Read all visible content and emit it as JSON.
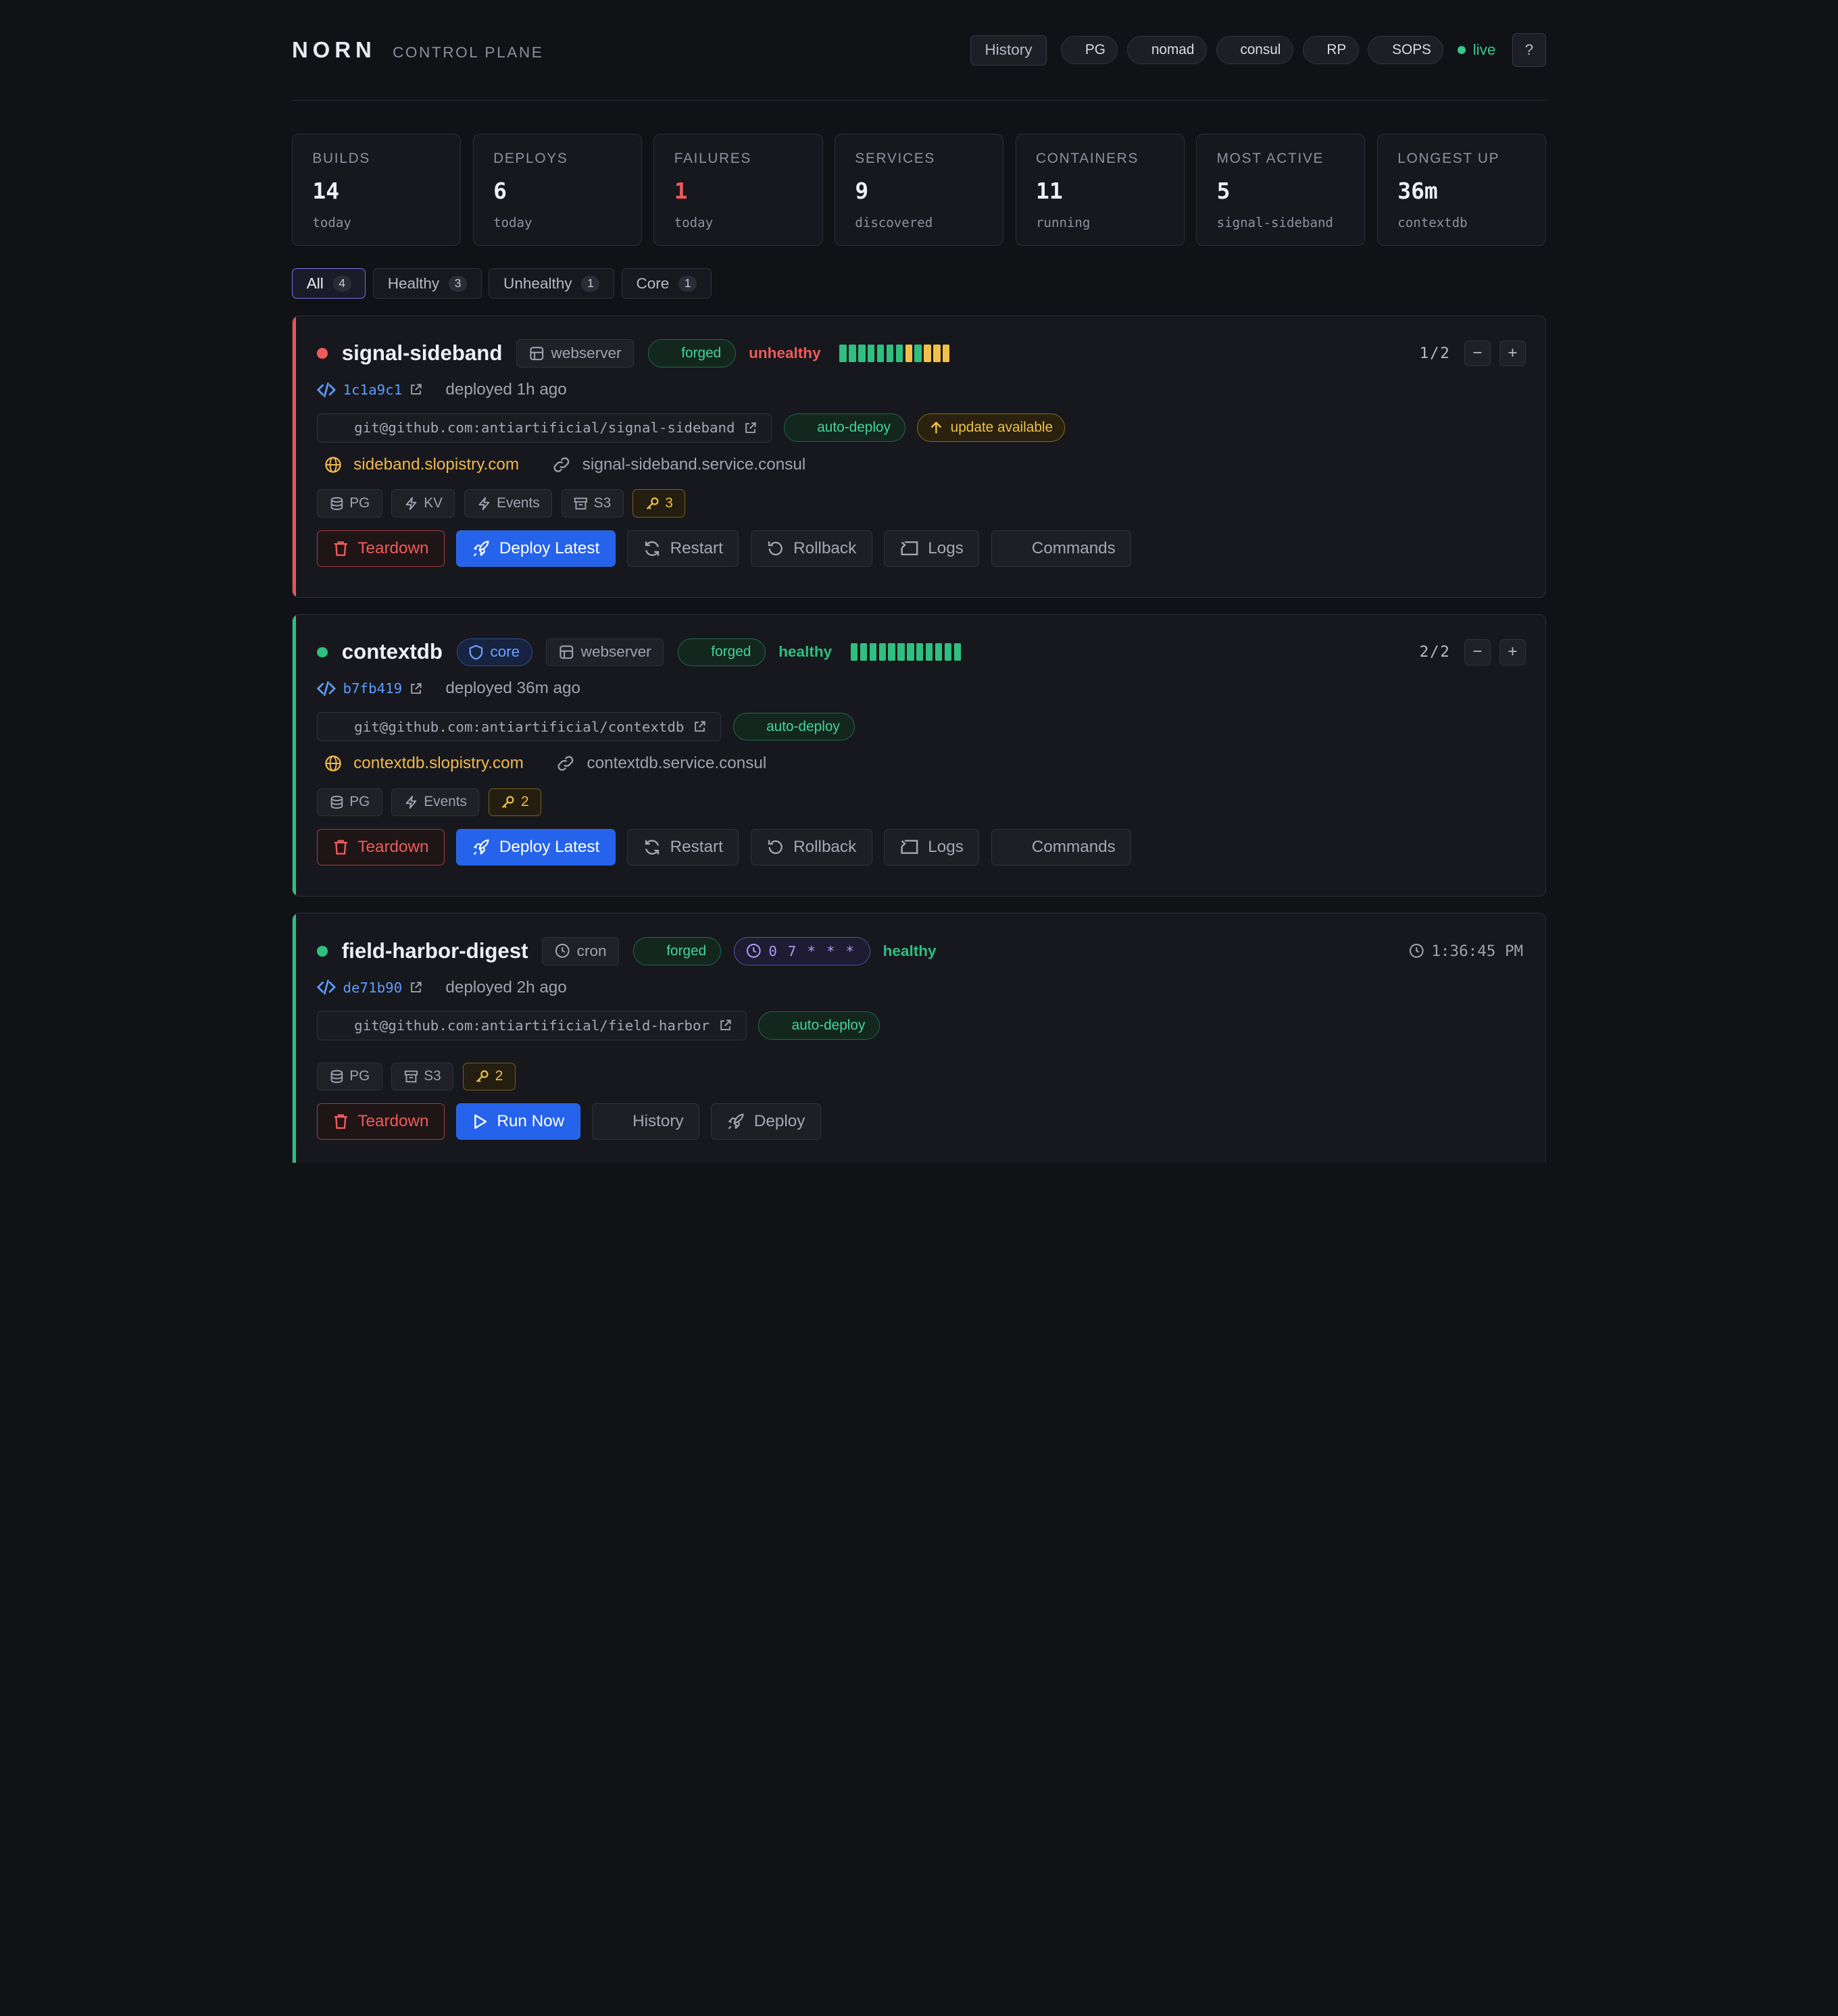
{
  "header": {
    "brand": "NORN",
    "subtitle": "CONTROL PLANE",
    "history_label": "History",
    "pills": [
      "PG",
      "nomad",
      "consul",
      "RP",
      "SOPS"
    ],
    "live_label": "live",
    "help_label": "?"
  },
  "stats": [
    {
      "label": "BUILDS",
      "value": "14",
      "sub": "today"
    },
    {
      "label": "DEPLOYS",
      "value": "6",
      "sub": "today"
    },
    {
      "label": "FAILURES",
      "value": "1",
      "sub": "today"
    },
    {
      "label": "SERVICES",
      "value": "9",
      "sub": "discovered"
    },
    {
      "label": "CONTAINERS",
      "value": "11",
      "sub": "running"
    },
    {
      "label": "MOST ACTIVE",
      "value": "5",
      "sub": "signal-sideband"
    },
    {
      "label": "LONGEST UP",
      "value": "36m",
      "sub": "contextdb"
    }
  ],
  "filters": [
    {
      "label": "All",
      "count": "4"
    },
    {
      "label": "Healthy",
      "count": "3"
    },
    {
      "label": "Unhealthy",
      "count": "1"
    },
    {
      "label": "Core",
      "count": "1"
    }
  ],
  "services": [
    {
      "name": "signal-sideband",
      "type": "webserver",
      "forged": "forged",
      "health": "unhealthy",
      "health_bars": [
        "g",
        "g",
        "g",
        "g",
        "g",
        "g",
        "g",
        "y",
        "g",
        "y",
        "y",
        "y"
      ],
      "replicas": "1/2",
      "commit": "1c1a9c1",
      "deployed": "deployed 1h ago",
      "repo": "git@github.com:antiartificial/signal-sideband",
      "auto_deploy": "auto-deploy",
      "update": "update available",
      "domain": "sideband.slopistry.com",
      "consul": "signal-sideband.service.consul",
      "resources": [
        "PG",
        "KV",
        "Events",
        "S3"
      ],
      "secrets": "3",
      "actions": [
        "Teardown",
        "Deploy Latest",
        "Restart",
        "Rollback",
        "Logs",
        "Commands"
      ]
    },
    {
      "name": "contextdb",
      "core": "core",
      "type": "webserver",
      "forged": "forged",
      "health": "healthy",
      "health_bars": [
        "g",
        "g",
        "g",
        "g",
        "g",
        "g",
        "g",
        "g",
        "g",
        "g",
        "g",
        "g"
      ],
      "replicas": "2/2",
      "commit": "b7fb419",
      "deployed": "deployed 36m ago",
      "repo": "git@github.com:antiartificial/contextdb",
      "auto_deploy": "auto-deploy",
      "domain": "contextdb.slopistry.com",
      "consul": "contextdb.service.consul",
      "resources": [
        "PG",
        "Events"
      ],
      "secrets": "2",
      "actions": [
        "Teardown",
        "Deploy Latest",
        "Restart",
        "Rollback",
        "Logs",
        "Commands"
      ]
    },
    {
      "name": "field-harbor-digest",
      "type": "cron",
      "forged": "forged",
      "schedule": "0 7 * * *",
      "health": "healthy",
      "next_run": "1:36:45 PM",
      "commit": "de71b90",
      "deployed": "deployed 2h ago",
      "repo": "git@github.com:antiartificial/field-harbor",
      "auto_deploy": "auto-deploy",
      "resources": [
        "PG",
        "S3"
      ],
      "secrets": "2",
      "actions": [
        "Teardown",
        "Run Now",
        "History",
        "Deploy"
      ]
    }
  ],
  "colors": {
    "accent": "#2563eb",
    "healthy": "#2fbf7f",
    "unhealthy": "#ef5a5a",
    "warning": "#f0c04a",
    "core": "#6ea1ff"
  }
}
